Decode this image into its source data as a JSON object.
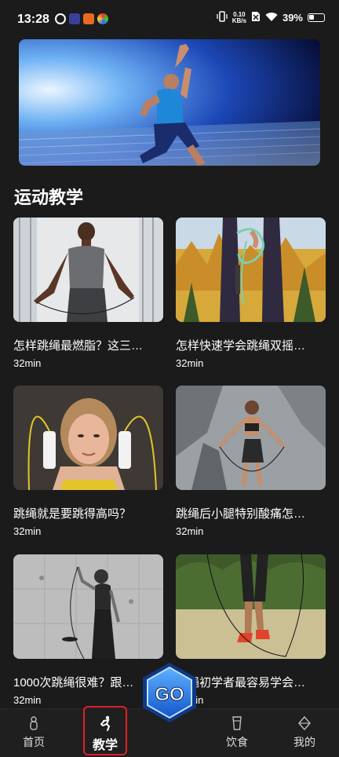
{
  "status_bar": {
    "time": "13:28",
    "speed_value": "0.10",
    "speed_unit": "KB/s",
    "battery": "39%"
  },
  "section_title": "运动教学",
  "videos": [
    {
      "title": "怎样跳绳最燃脂？这三…",
      "duration": "32min"
    },
    {
      "title": "怎样快速学会跳绳双摇…",
      "duration": "32min"
    },
    {
      "title": "跳绳就是要跳得高吗？",
      "duration": "32min"
    },
    {
      "title": "跳绳后小腿特别酸痛怎…",
      "duration": "32min"
    },
    {
      "title": "1000次跳绳很难？跟…",
      "duration": "32min"
    },
    {
      "title": "跳绳初学者最容易学会…",
      "duration": "32min"
    }
  ],
  "badge_text": "GO",
  "tabs": [
    {
      "label": "首页",
      "icon": "home-icon"
    },
    {
      "label": "教学",
      "icon": "runner-icon"
    },
    {
      "label": "饮食",
      "icon": "cup-icon"
    },
    {
      "label": "我的",
      "icon": "profile-icon"
    }
  ],
  "colors": {
    "background": "#1b1b1b",
    "active_border": "#e0202a",
    "badge_blue": "#1e78e8"
  }
}
